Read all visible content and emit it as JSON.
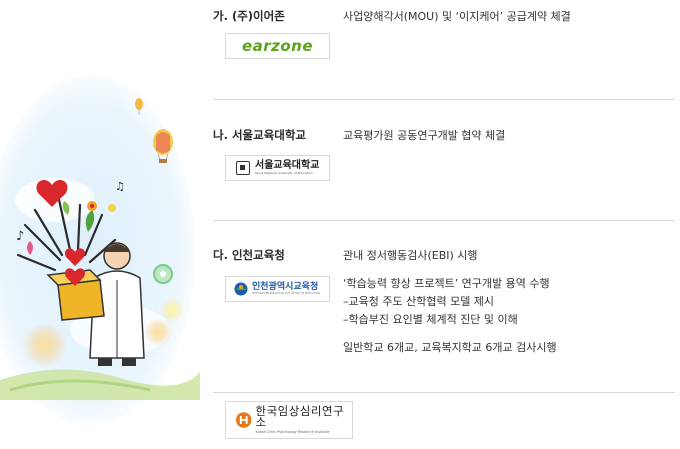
{
  "entries": [
    {
      "name": "가. (주)이어존",
      "lines": [
        "사업양해각서(MOU) 및 ‘이지케어’ 공급계약 체결"
      ],
      "logo_text": "earzone"
    },
    {
      "name": "나. 서울교육대학교",
      "lines": [
        "교육평가원 공동연구개발 협약 체결"
      ],
      "logo_text": "서울교육대학교",
      "logo_subtext": "Seoul National University of Education"
    },
    {
      "name": "다. 인천교육청",
      "lines": [
        "관내 정서행동검사(EBI) 시행",
        "‘학습능력 향상 프로젝트’ 연구개발 용역 수행",
        "–교육청 주도 산학협력 모델 제시",
        "–학습부진 요인별 체계적 진단 및 이해",
        "일반학교 6개교, 교육복지학교 6개교 검사시행"
      ],
      "logo_text": "인천광역시교육청",
      "logo_subtext": "INCHEON METROPOLITAN CITY OFFICE OF EDUCATION"
    },
    {
      "name": "",
      "lines": [],
      "logo_text": "한국임상심리연구소",
      "logo_subtext": "Korea Clinic Psychology Research Institute"
    }
  ],
  "colors": {
    "separator": "#d8d8d8",
    "earzone_green": "#5aa21e",
    "heart_red": "#d9272e",
    "incheon_blue": "#1e5aa8",
    "kcpri_orange": "#e8781e"
  }
}
